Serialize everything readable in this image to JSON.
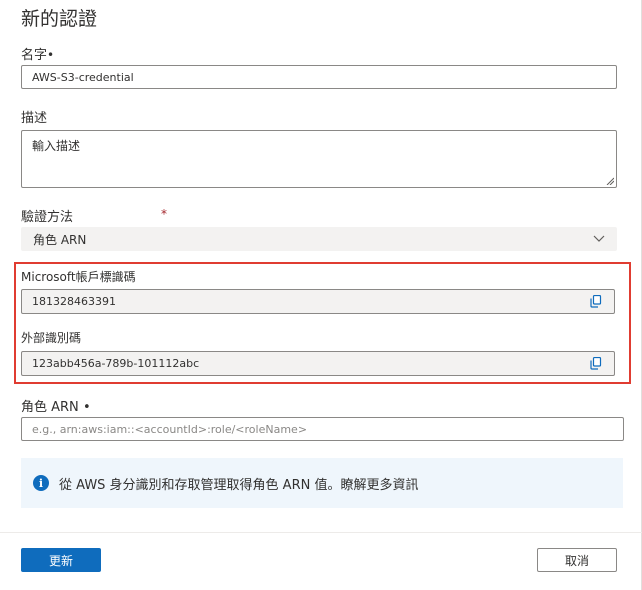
{
  "panel": {
    "title": "新的認證"
  },
  "name_field": {
    "label": "名字",
    "required_mark": "•",
    "value": "AWS-S3-credential"
  },
  "description_field": {
    "label": "描述",
    "placeholder": "輸入描述"
  },
  "auth_method": {
    "label": "驗證方法",
    "required_mark": "*",
    "selected": "角色 ARN"
  },
  "microsoft_account_id": {
    "label": "Microsoft帳戶標識碼",
    "value": "181328463391"
  },
  "external_id": {
    "label": "外部識別碼",
    "value": "123abb456a-789b-101112abc"
  },
  "role_arn": {
    "label": "角色 ARN",
    "required_mark": "•",
    "placeholder": "e.g., arn:aws:iam::<accountId>:role/<roleName>"
  },
  "info": {
    "text": "從 AWS 身分識別和存取管理取得角色 ARN 值。瞭解更多資訊"
  },
  "footer": {
    "update_label": "更新",
    "cancel_label": "取消"
  },
  "colors": {
    "accent": "#0f6cbd",
    "highlight_border": "#e03c31",
    "info_background": "#eff6fc",
    "readonly_background": "#f3f2f1"
  }
}
